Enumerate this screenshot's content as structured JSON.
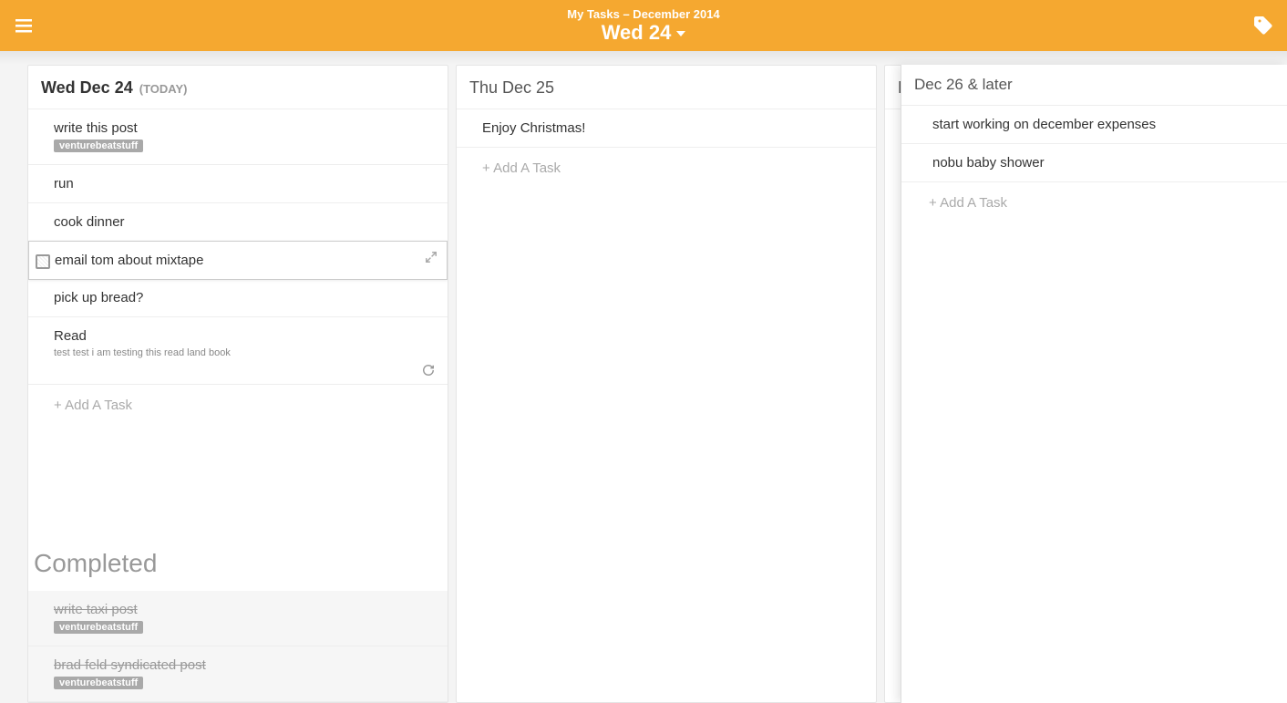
{
  "header": {
    "subtitle": "My Tasks – December 2014",
    "title": "Wed 24"
  },
  "addTaskLabel": "+ Add A Task",
  "completedLabel": "Completed",
  "columns": {
    "today": {
      "title": "Wed Dec 24",
      "badge": "(TODAY)",
      "tasks": [
        {
          "title": "write this post",
          "tag": "venturebeatstuff"
        },
        {
          "title": "run"
        },
        {
          "title": "cook dinner"
        },
        {
          "title": "email tom about mixtape",
          "selected": true
        },
        {
          "title": "pick up bread?"
        },
        {
          "title": "Read",
          "note": "test test i am testing this read land book",
          "reload": true
        }
      ],
      "completed": [
        {
          "title": "write taxi post",
          "tag": "venturebeatstuff"
        },
        {
          "title": "brad feld syndicated post",
          "tag": "venturebeatstuff"
        }
      ]
    },
    "thu": {
      "title": "Thu Dec 25",
      "tasks": [
        {
          "title": "Enjoy Christmas!"
        }
      ]
    },
    "fri": {
      "title": "Fr"
    }
  },
  "later": {
    "title": "Dec 26 & later",
    "tasks": [
      {
        "title": "start working on december expenses"
      },
      {
        "title": "nobu baby shower"
      }
    ]
  }
}
